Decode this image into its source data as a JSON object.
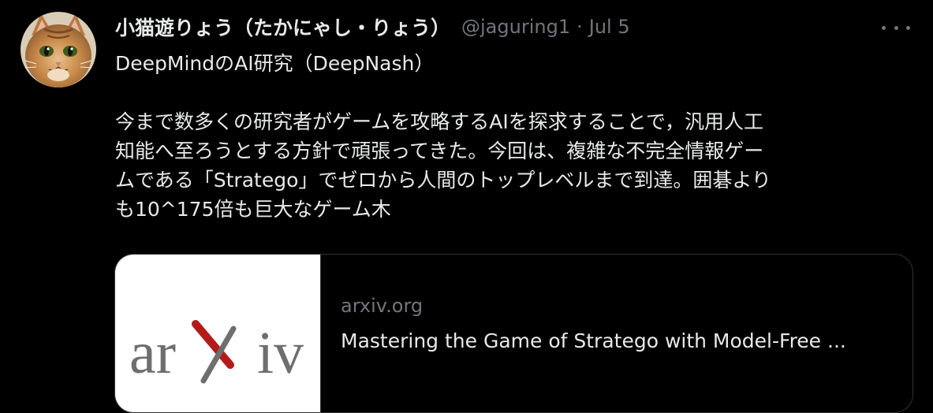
{
  "tweet": {
    "display_name": "小猫遊りょう（たかにゃし・りょう）",
    "handle": "@jaguring1",
    "separator": "·",
    "date": "Jul 5",
    "lines_block1": [
      "DeepMindのAI研究（DeepNash）"
    ],
    "lines_block2": [
      "今まで数多くの研究者がゲームを攻略するAIを探求することで，汎用人工",
      "知能へ至ろうとする方針で頑張ってきた。今回は、複雑な不完全情報ゲー",
      "ムである「Stratego」でゼロから人間のトップレベルまで到達。囲碁より",
      "も10^175倍も巨大なゲーム木"
    ]
  },
  "card": {
    "domain": "arxiv.org",
    "title": "Mastering the Game of Stratego with Model-Free ...",
    "logo_text": "arXiv",
    "logo_color": "#b31b1b",
    "logo_text_color": "#6e6e6e"
  },
  "colors": {
    "background": "#000000",
    "primary_text": "#e7e9ea",
    "secondary_text": "#71767b",
    "border": "#2f3336"
  },
  "icons": {
    "more": "more-dots-icon",
    "avatar": "cat-avatar"
  }
}
